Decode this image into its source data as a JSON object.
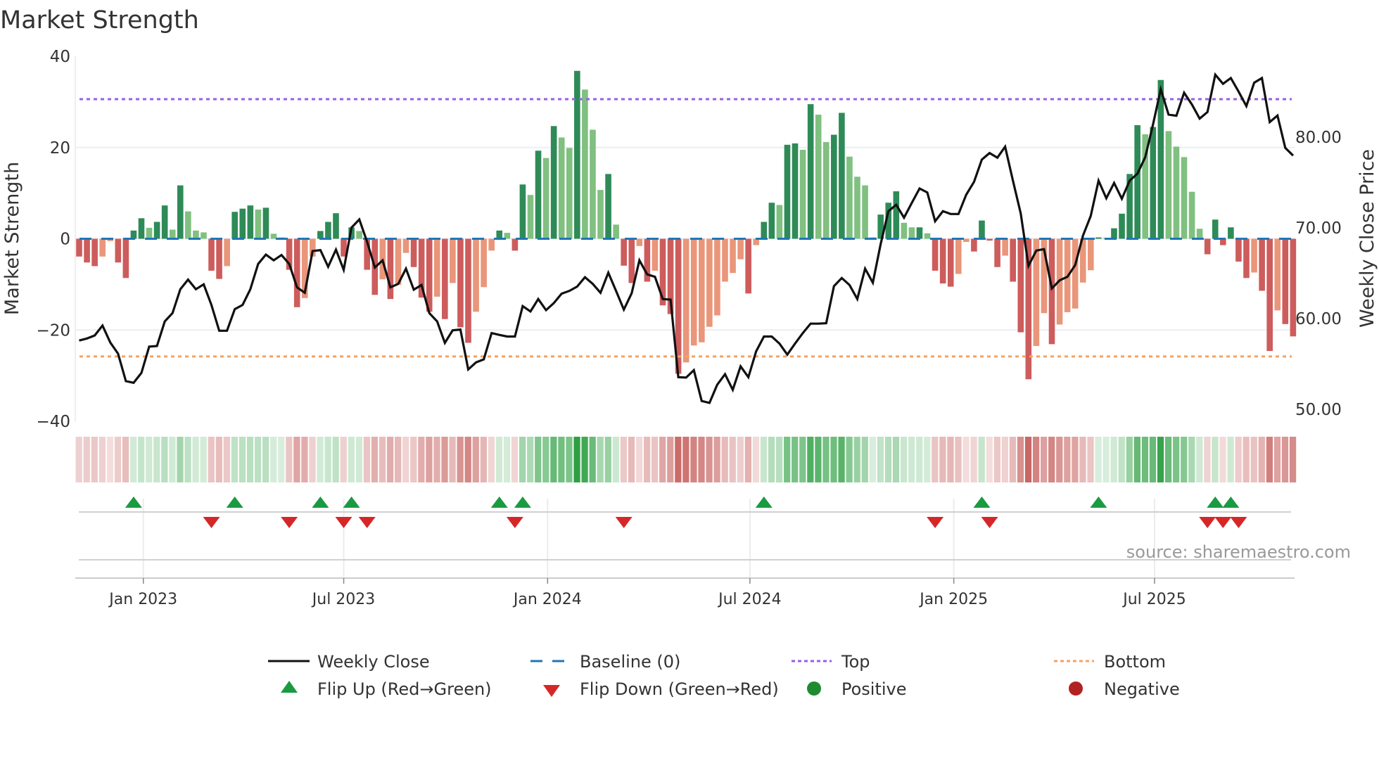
{
  "chart_data": {
    "type": "bar",
    "title": "Market Strength",
    "ylabel": "Market Strength",
    "y2label": "Weekly Close Price",
    "ylim": [
      -40,
      40
    ],
    "y2lim": [
      48.7,
      88.9
    ],
    "yticks": [
      {
        "v": 40,
        "label": "40"
      },
      {
        "v": 20,
        "label": "20"
      },
      {
        "v": 0,
        "label": "0"
      },
      {
        "v": -20,
        "label": "−20"
      },
      {
        "v": -40,
        "label": "−40"
      }
    ],
    "y2ticks": [
      {
        "v": 80,
        "label": "80.00"
      },
      {
        "v": 70,
        "label": "70.00"
      },
      {
        "v": 60,
        "label": "60.00"
      },
      {
        "v": 50,
        "label": "50.00"
      }
    ],
    "xticks": [
      {
        "bar": 9.25,
        "label": "Jan 2023"
      },
      {
        "bar": 35.0,
        "label": "Jul 2023"
      },
      {
        "bar": 61.2,
        "label": "Jan 2024"
      },
      {
        "bar": 87.2,
        "label": "Jul 2024"
      },
      {
        "bar": 113.4,
        "label": "Jan 2025"
      },
      {
        "bar": 139.2,
        "label": "Jul 2025"
      }
    ],
    "grid": true,
    "top_level": 30.6,
    "bottom_level": -25.8,
    "baseline": 0,
    "strength_values": [
      -3.9,
      -5.2,
      -6.0,
      -3.9,
      -0.5,
      -5.2,
      -8.6,
      1.8,
      4.5,
      2.4,
      3.7,
      7.3,
      2.0,
      11.7,
      6.0,
      1.8,
      1.4,
      -7.0,
      -8.8,
      -6.0,
      5.9,
      6.6,
      7.3,
      6.4,
      6.8,
      1.1,
      0.3,
      -6.8,
      -15.0,
      -13.0,
      -3.9,
      1.7,
      3.7,
      5.6,
      -3.9,
      2.5,
      1.7,
      -6.8,
      -12.3,
      -8.9,
      -13.2,
      -10.1,
      -3.1,
      -6.2,
      -12.9,
      -16.0,
      -12.7,
      -17.6,
      -9.7,
      -19.4,
      -22.8,
      -16.0,
      -10.6,
      -2.6,
      1.8,
      1.3,
      -2.6,
      11.9,
      9.6,
      19.3,
      17.7,
      24.7,
      22.2,
      19.9,
      36.8,
      32.7,
      23.9,
      10.7,
      14.2,
      3.1,
      -5.9,
      -9.7,
      -1.6,
      -9.4,
      -7.0,
      -14.6,
      -16.5,
      -29.6,
      -27.1,
      -23.4,
      -22.7,
      -19.3,
      -16.8,
      -9.4,
      -7.5,
      -4.5,
      -12.0,
      -1.4,
      3.7,
      7.9,
      7.4,
      20.6,
      20.9,
      19.5,
      29.5,
      27.2,
      21.2,
      22.8,
      27.6,
      18.0,
      13.6,
      11.7,
      0.3,
      5.3,
      7.9,
      10.4,
      3.5,
      2.5,
      2.5,
      1.2,
      -7.0,
      -9.8,
      -10.5,
      -7.7,
      -0.7,
      -2.8,
      4.0,
      -0.4,
      -6.2,
      -3.7,
      -9.4,
      -20.5,
      -30.8,
      -23.5,
      -16.3,
      -23.1,
      -18.8,
      -16.1,
      -15.3,
      -9.6,
      -6.9,
      0.3,
      0.2,
      2.3,
      5.5,
      14.2,
      24.9,
      22.9,
      24.5,
      34.8,
      23.6,
      20.2,
      17.9,
      10.3,
      2.2,
      -3.4,
      4.2,
      -1.4,
      2.5,
      -5.0,
      -8.6,
      -7.4,
      -11.4,
      -24.6,
      -15.7,
      -18.7,
      -21.4
    ],
    "weekly_close": [
      57.59,
      57.82,
      58.15,
      59.24,
      57.38,
      56.14,
      53.12,
      52.94,
      54.02,
      56.92,
      56.99,
      59.7,
      60.61,
      63.24,
      64.3,
      63.24,
      63.78,
      61.51,
      58.67,
      58.67,
      61.05,
      61.51,
      63.24,
      66.03,
      67.06,
      66.42,
      67.01,
      66.03,
      63.45,
      62.85,
      67.45,
      67.55,
      65.72,
      67.6,
      65.38,
      70.03,
      70.93,
      68.48,
      65.64,
      66.42,
      63.45,
      63.83,
      65.51,
      63.19,
      63.71,
      60.61,
      59.7,
      57.33,
      58.72,
      58.8,
      54.41,
      55.18,
      55.52,
      58.41,
      58.21,
      58.03,
      58.03,
      61.38,
      60.79,
      62.16,
      60.94,
      61.72,
      62.75,
      63.06,
      63.53,
      64.56,
      63.83,
      62.85,
      65.07,
      63.06,
      61.0,
      62.8,
      66.42,
      64.87,
      64.61,
      62.16,
      62.1,
      53.56,
      53.51,
      54.33,
      50.93,
      50.72,
      52.73,
      53.89,
      52.16,
      54.75,
      53.56,
      56.4,
      58.03,
      58.03,
      57.25,
      56.04,
      57.25,
      58.41,
      59.45,
      59.45,
      59.5,
      63.58,
      64.48,
      63.71,
      62.16,
      65.51,
      63.96,
      68.22,
      71.84,
      72.54,
      71.12,
      72.74,
      74.34,
      73.9,
      70.73,
      71.84,
      71.53,
      71.53,
      73.65,
      75.07,
      77.52,
      78.24,
      77.73,
      78.94,
      75.2,
      71.58,
      65.82,
      67.5,
      67.66,
      63.32,
      64.22,
      64.61,
      65.9,
      69.13,
      71.32,
      75.2,
      73.26,
      74.94,
      73.21,
      75.2,
      75.97,
      77.78,
      81.39,
      85.27,
      82.48,
      82.35,
      84.88,
      83.59,
      82.04,
      82.76,
      86.87,
      85.86,
      86.5,
      85.01,
      83.41,
      85.99,
      86.5,
      81.65,
      82.37,
      78.81,
      77.96
    ],
    "legend": {
      "placement": "bottom",
      "weekly_close": "Weekly Close",
      "baseline": "Baseline (0)",
      "top": "Top",
      "bottom": "Bottom",
      "flip_up": "Flip Up (Red→Green)",
      "flip_down": "Flip Down (Green→Red)",
      "positive": "Positive",
      "negative": "Negative"
    },
    "colors": {
      "pos_rising": "#2e8b57",
      "pos_falling": "#80c080",
      "neg_falling": "#cd5c5c",
      "neg_rising": "#e9967a",
      "close": "#111111",
      "baseline": "#1f77b4",
      "top": "#9b5de5",
      "bottom": "#f4a261",
      "flip_up": "#1a9a41",
      "flip_down": "#d62728",
      "positive": "#1e8c2e",
      "negative": "#b22222",
      "heat_pos": "#2ea043",
      "heat_neg": "#c0504d"
    }
  },
  "source": "source: sharemaestro.com"
}
